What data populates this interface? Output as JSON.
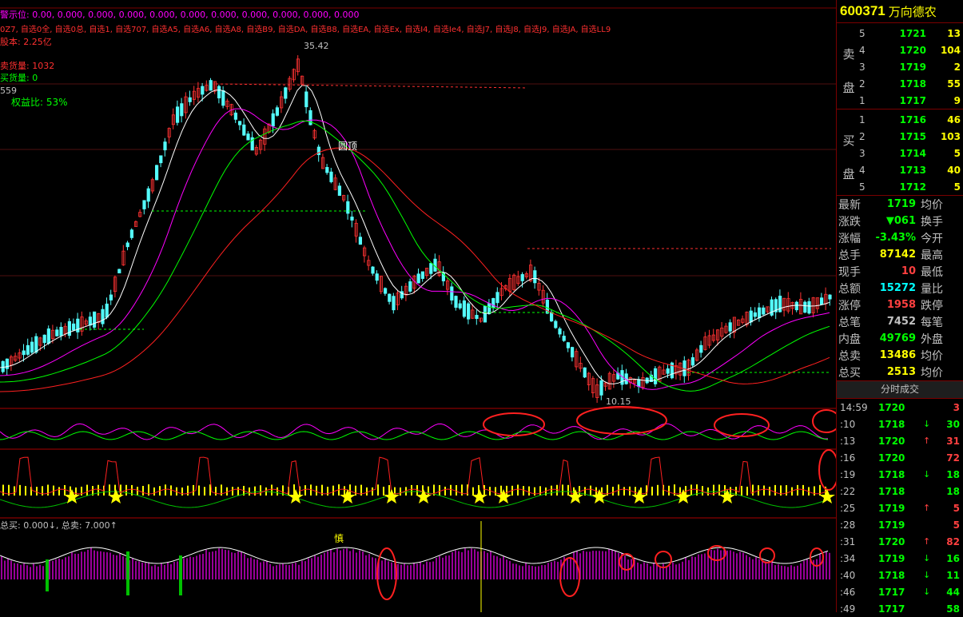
{
  "overlay": {
    "warn_label": "警示位: 0.00, 0.000, 0.000, 0.000, 0.000, 0.000, 0.000, 0.000, 0.000, 0.000, 0.000",
    "watchlists": "0Z7, 自选0全, 自选0总, 自选1, 自选707, 自选A5, 自选A6, 自选A8, 自选B9, 自选DA, 自选B8, 自选EA, 自选Ex, 自选I4, 自选Ie4, 自选J7, 自选J8, 自选J9, 自选JA, 自选LL9",
    "capital": "股本: 2.25亿",
    "sell_qty": "卖货量: 1032",
    "buy_qty": "买货量: 0",
    "num_559": "559",
    "equity_ratio": "权益比: 53%",
    "peak_price": "35.42",
    "round_top": "圆顶",
    "low_price": "10.15",
    "total_buy_sell": "总买: 0.000↓, 总卖: 7.000↑",
    "caution": "慎"
  },
  "stock": {
    "code": "600371",
    "name": "万向德农"
  },
  "book": {
    "sell_label": [
      "卖",
      "盘"
    ],
    "buy_label": [
      "买",
      "盘"
    ],
    "sells": [
      {
        "level": "5",
        "price": "1721",
        "vol": "13"
      },
      {
        "level": "4",
        "price": "1720",
        "vol": "104"
      },
      {
        "level": "3",
        "price": "1719",
        "vol": "2"
      },
      {
        "level": "2",
        "price": "1718",
        "vol": "55"
      },
      {
        "level": "1",
        "price": "1717",
        "vol": "9"
      }
    ],
    "buys": [
      {
        "level": "1",
        "price": "1716",
        "vol": "46"
      },
      {
        "level": "2",
        "price": "1715",
        "vol": "103"
      },
      {
        "level": "3",
        "price": "1714",
        "vol": "5"
      },
      {
        "level": "4",
        "price": "1713",
        "vol": "40"
      },
      {
        "level": "5",
        "price": "1712",
        "vol": "5"
      }
    ]
  },
  "stats": [
    {
      "k": "最新",
      "v": "1719",
      "c": "#00ff00",
      "k2": "均价"
    },
    {
      "k": "涨跌",
      "v": "▼061",
      "c": "#00ff00",
      "k2": "换手"
    },
    {
      "k": "涨幅",
      "v": "-3.43%",
      "c": "#00ff00",
      "k2": "今开"
    },
    {
      "k": "总手",
      "v": "87142",
      "c": "#ffff00",
      "k2": "最高"
    },
    {
      "k": "现手",
      "v": "10",
      "c": "#ff4040",
      "k2": "最低"
    },
    {
      "k": "总额",
      "v": "15272",
      "c": "#00ffff",
      "k2": "量比"
    },
    {
      "k": "涨停",
      "v": "1958",
      "c": "#ff4040",
      "k2": "跌停"
    },
    {
      "k": "总笔",
      "v": "7452",
      "c": "#c0c0c0",
      "k2": "每笔"
    },
    {
      "k": "内盘",
      "v": "49769",
      "c": "#00ff00",
      "k2": "外盘"
    },
    {
      "k": "总卖",
      "v": "13486",
      "c": "#ffff00",
      "k2": "均价"
    },
    {
      "k": "总买",
      "v": "2513",
      "c": "#ffff00",
      "k2": "均价"
    }
  ],
  "ticks_title": "分时成交",
  "ticks": [
    {
      "t": "14:59",
      "p": "1720",
      "a": "",
      "q": "3",
      "pc": "#00ff00",
      "qc": "#ff4040"
    },
    {
      "t": ":10",
      "p": "1718",
      "a": "↓",
      "q": "30",
      "pc": "#00ff00",
      "qc": "#00ff00"
    },
    {
      "t": ":13",
      "p": "1720",
      "a": "↑",
      "q": "31",
      "pc": "#00ff00",
      "qc": "#ff4040"
    },
    {
      "t": ":16",
      "p": "1720",
      "a": "",
      "q": "72",
      "pc": "#00ff00",
      "qc": "#ff4040"
    },
    {
      "t": ":19",
      "p": "1718",
      "a": "↓",
      "q": "18",
      "pc": "#00ff00",
      "qc": "#00ff00"
    },
    {
      "t": ":22",
      "p": "1718",
      "a": "",
      "q": "18",
      "pc": "#00ff00",
      "qc": "#00ff00"
    },
    {
      "t": ":25",
      "p": "1719",
      "a": "↑",
      "q": "5",
      "pc": "#00ff00",
      "qc": "#ff4040"
    },
    {
      "t": ":28",
      "p": "1719",
      "a": "",
      "q": "5",
      "pc": "#00ff00",
      "qc": "#ff4040"
    },
    {
      "t": ":31",
      "p": "1720",
      "a": "↑",
      "q": "82",
      "pc": "#00ff00",
      "qc": "#ff4040"
    },
    {
      "t": ":34",
      "p": "1719",
      "a": "↓",
      "q": "16",
      "pc": "#00ff00",
      "qc": "#00ff00"
    },
    {
      "t": ":40",
      "p": "1718",
      "a": "↓",
      "q": "11",
      "pc": "#00ff00",
      "qc": "#00ff00"
    },
    {
      "t": ":46",
      "p": "1717",
      "a": "↓",
      "q": "44",
      "pc": "#00ff00",
      "qc": "#00ff00"
    },
    {
      "t": ":49",
      "p": "1717",
      "a": "",
      "q": "58",
      "pc": "#00ff00",
      "qc": "#00ff00"
    }
  ],
  "colors": {
    "up": "#ff3232",
    "down": "#54fcfc",
    "ma_white": "#ffffff",
    "ma_magenta": "#ff00ff",
    "ma_green": "#00ff00",
    "ma_red": "#ff2020",
    "annot_circle": "#ff2020"
  }
}
